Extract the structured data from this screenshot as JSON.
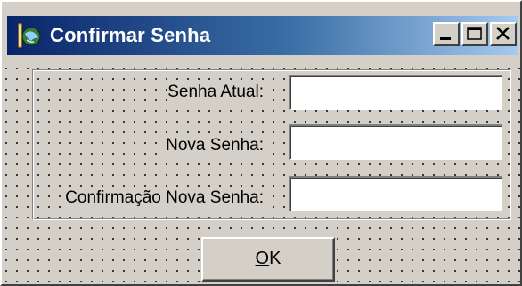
{
  "window": {
    "title": "Confirmar Senha",
    "icon": "app-globe-icon",
    "controls": [
      "minimize-icon",
      "maximize-icon",
      "close-icon"
    ]
  },
  "form": {
    "fields": [
      {
        "label": "Senha Atual:",
        "value": "",
        "placeholder": ""
      },
      {
        "label": "Nova Senha:",
        "value": "",
        "placeholder": ""
      },
      {
        "label": "Confirmação Nova Senha:",
        "value": "",
        "placeholder": ""
      }
    ]
  },
  "buttons": {
    "ok_mnemonic": "O",
    "ok_rest": "K"
  },
  "colors": {
    "titlebar_start": "#0a246a",
    "titlebar_end": "#a6caf0",
    "face": "#d4d0c8"
  }
}
